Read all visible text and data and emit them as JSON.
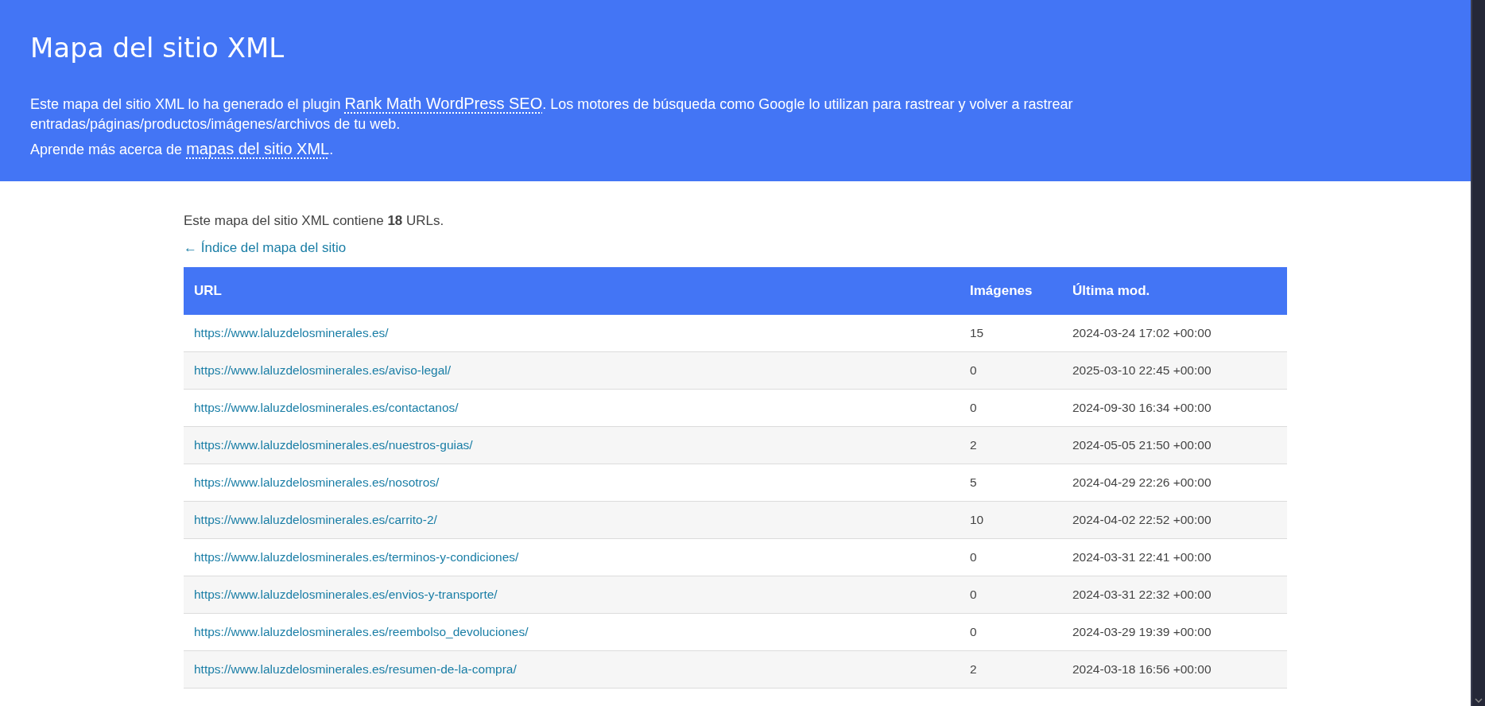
{
  "header": {
    "title": "Mapa del sitio XML",
    "intro": {
      "before": "Este mapa del sitio XML lo ha generado el plugin ",
      "link": "Rank Math WordPress SEO",
      "after": ". Los motores de búsqueda como Google lo utilizan para rastrear y volver a rastrear entradas/páginas/productos/imágenes/archivos de tu web."
    },
    "learn": {
      "before": "Aprende más acerca de ",
      "link": "mapas del sitio XML",
      "after": "."
    }
  },
  "summary": "Este mapa del sitio XML contiene **18** URLs.",
  "back_link": "← Índice del mapa del sitio",
  "table": {
    "columns": [
      "URL",
      "Imágenes",
      "Última mod."
    ],
    "rows": [
      {
        "url": "https://www.laluzdelosminerales.es/",
        "images": "15",
        "modified": "2024-03-24 17:02 +00:00"
      },
      {
        "url": "https://www.laluzdelosminerales.es/aviso-legal/",
        "images": "0",
        "modified": "2025-03-10 22:45 +00:00"
      },
      {
        "url": "https://www.laluzdelosminerales.es/contactanos/",
        "images": "0",
        "modified": "2024-09-30 16:34 +00:00"
      },
      {
        "url": "https://www.laluzdelosminerales.es/nuestros-guias/",
        "images": "2",
        "modified": "2024-05-05 21:50 +00:00"
      },
      {
        "url": "https://www.laluzdelosminerales.es/nosotros/",
        "images": "5",
        "modified": "2024-04-29 22:26 +00:00"
      },
      {
        "url": "https://www.laluzdelosminerales.es/carrito-2/",
        "images": "10",
        "modified": "2024-04-02 22:52 +00:00"
      },
      {
        "url": "https://www.laluzdelosminerales.es/terminos-y-condiciones/",
        "images": "0",
        "modified": "2024-03-31 22:41 +00:00"
      },
      {
        "url": "https://www.laluzdelosminerales.es/envios-y-transporte/",
        "images": "0",
        "modified": "2024-03-31 22:32 +00:00"
      },
      {
        "url": "https://www.laluzdelosminerales.es/reembolso_devoluciones/",
        "images": "0",
        "modified": "2024-03-29 19:39 +00:00"
      },
      {
        "url": "https://www.laluzdelosminerales.es/resumen-de-la-compra/",
        "images": "2",
        "modified": "2024-03-18 16:56 +00:00"
      }
    ]
  }
}
